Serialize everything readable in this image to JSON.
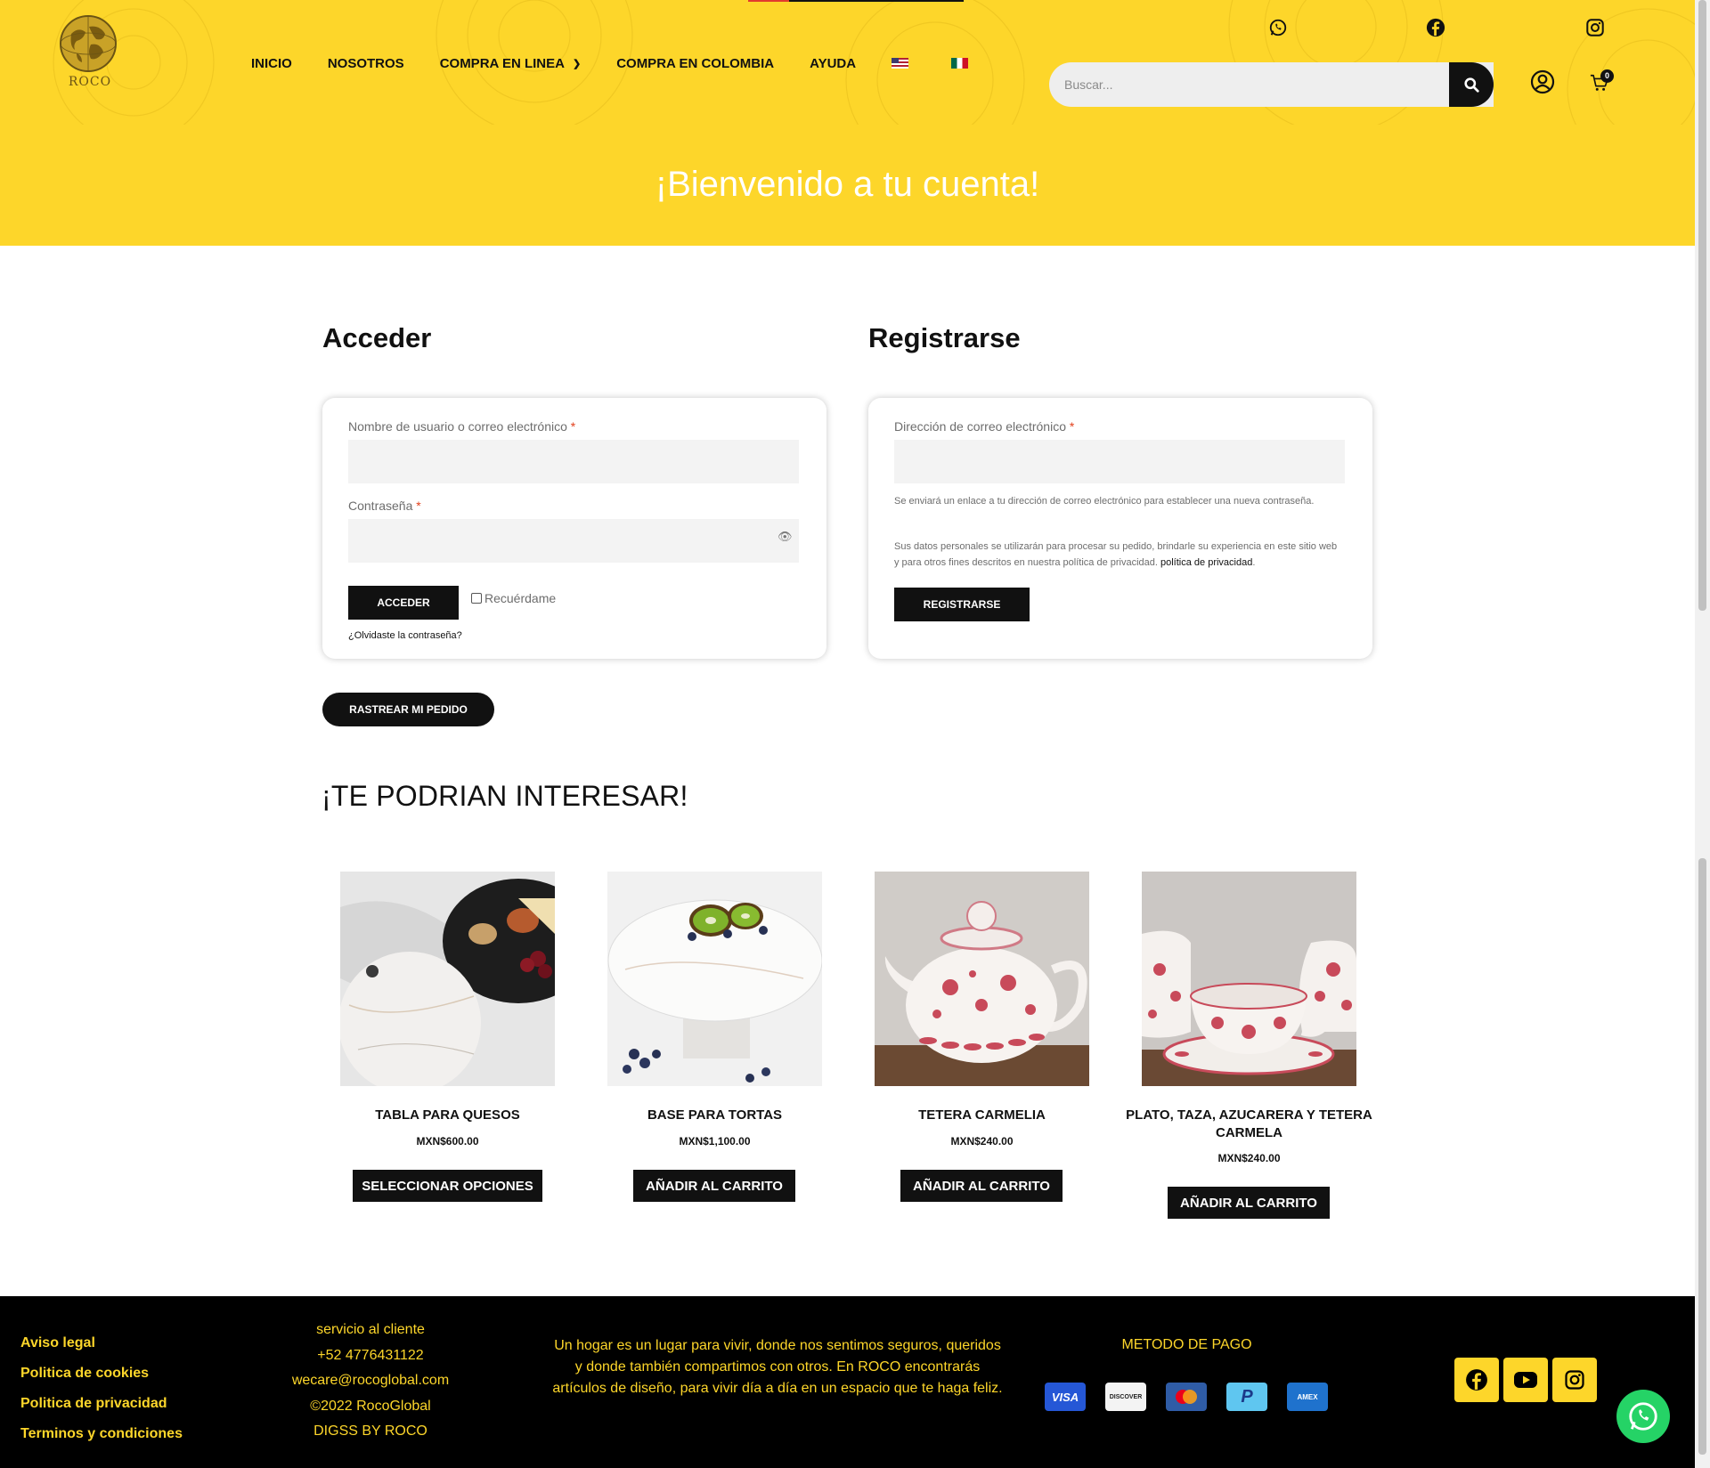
{
  "brand": {
    "logo_text": "ROCO"
  },
  "nav": {
    "items": [
      {
        "label": "INICIO"
      },
      {
        "label": "NOSOTROS"
      },
      {
        "label": "COMPRA EN LINEA",
        "has_dropdown": true
      },
      {
        "label": "COMPRA EN COLOMBIA"
      },
      {
        "label": "AYUDA"
      }
    ],
    "flags": [
      "us-flag-icon",
      "mexico-flag-icon"
    ]
  },
  "social_top": [
    "whatsapp-icon",
    "facebook-icon",
    "instagram-icon"
  ],
  "search": {
    "placeholder": "Buscar..."
  },
  "cart": {
    "count": "0"
  },
  "banner": {
    "title": "¡Bienvenido a tu cuenta!"
  },
  "login": {
    "title": "Acceder",
    "username_label": "Nombre de usuario o correo electrónico",
    "password_label": "Contraseña",
    "required_mark": "*",
    "submit_label": "ACCEDER",
    "remember_label": "Recuérdame",
    "lost_password": "¿Olvidaste la contraseña?"
  },
  "register": {
    "title": "Registrarse",
    "email_label": "Dirección de correo electrónico",
    "required_mark": "*",
    "note_link": "Se enviará un enlace a tu dirección de correo electrónico para establecer una nueva contraseña.",
    "note_privacy": "Sus datos personales se utilizarán para procesar su pedido, brindarle su experiencia en este sitio web y para otros fines descritos en nuestra política de privacidad.",
    "privacy_link": "política de privacidad",
    "submit_label": "REGISTRARSE"
  },
  "track_order": {
    "label": "RASTREAR MI PEDIDO"
  },
  "recommendations": {
    "title": "¡TE PODRIAN INTERESAR!",
    "products": [
      {
        "name": "TABLA PARA QUESOS",
        "price": "MXN$600.00",
        "button": "SELECCIONAR OPCIONES"
      },
      {
        "name": "BASE PARA TORTAS",
        "price": "MXN$1,100.00",
        "button": "AÑADIR AL CARRITO"
      },
      {
        "name": "TETERA CARMELIA",
        "price": "MXN$240.00",
        "button": "AÑADIR AL CARRITO"
      },
      {
        "name": "PLATO, TAZA, AZUCARERA Y TETERA CARMELA",
        "price": "MXN$240.00",
        "button": "AÑADIR AL CARRITO"
      }
    ]
  },
  "footer": {
    "legal": [
      "Aviso legal",
      "Politica de cookies",
      "Politica de privacidad",
      "Terminos y condiciones"
    ],
    "contact": [
      "servicio al cliente",
      "+52 4776431122",
      "wecare@rocoglobal.com",
      "©2022 RocoGlobal",
      "DIGSS BY ROCO"
    ],
    "about": "Un hogar es un lugar para vivir, donde nos sentimos seguros, queridos y donde también compartimos con otros. En ROCO encontrarás artículos de diseño, para vivir día a día en un espacio que te haga feliz.",
    "payment_title": "METODO DE PAGO",
    "payment_methods": [
      "VISA",
      "DISCOVER",
      "mastercard",
      "P",
      "AMEX"
    ],
    "social": [
      "facebook-icon",
      "youtube-icon",
      "instagram-icon"
    ]
  },
  "colors": {
    "accent": "#fdd62a",
    "dark": "#111111",
    "whatsapp": "#25d366",
    "required": "#e2401c"
  }
}
